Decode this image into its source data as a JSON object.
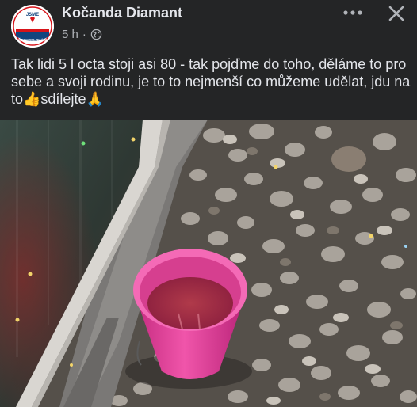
{
  "post": {
    "author": "Kočanda Diamant",
    "time": "5 h",
    "separator": "·",
    "text": "Tak lidi 5 l octa stoji asi 80 - tak pojďme do toho, děláme to pro sebe a svoji rodinu, je to to nejmenší co můžeme udělat, jdu na to👍sdílejte🙏",
    "avatar_text_top": "JSME",
    "avatar_text_bottom": "ČECHOSLOVÁCI",
    "audience_icon": "globe-icon"
  },
  "header": {
    "more_icon": "more-options-icon",
    "close_icon": "close-icon"
  },
  "photo": {
    "subject": "pink bucket on gravel next to window"
  },
  "colors": {
    "background": "#242526",
    "text": "#e4e6eb",
    "secondary": "#b0b3b8",
    "bucket": "#e83b9a"
  }
}
